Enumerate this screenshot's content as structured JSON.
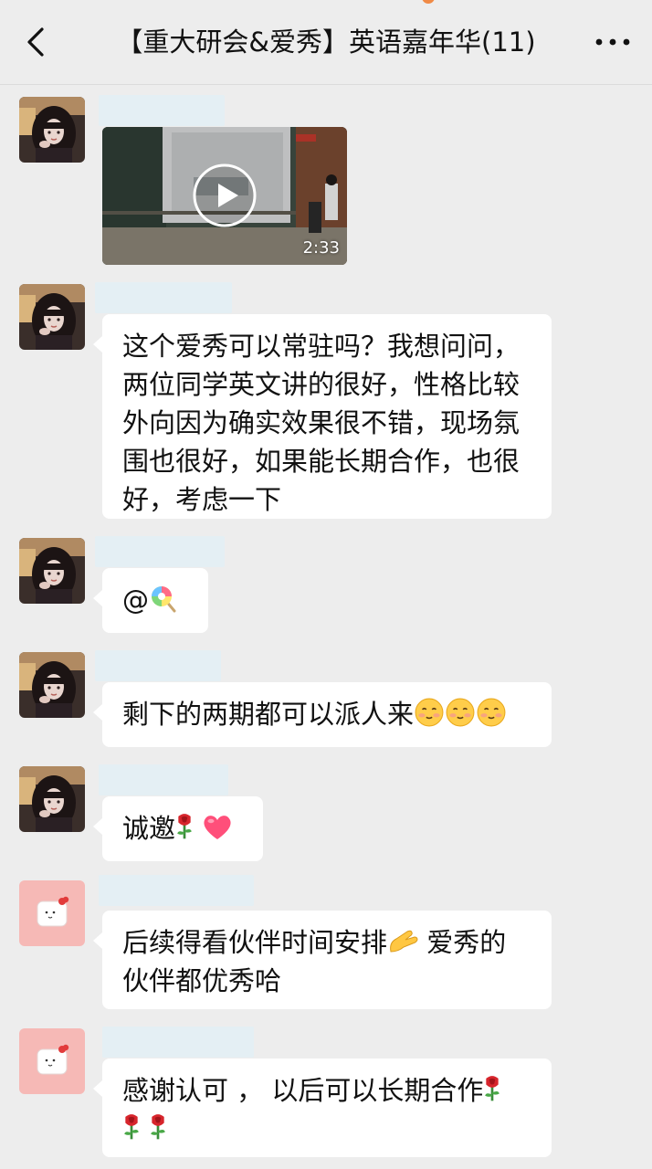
{
  "header": {
    "title": "【重大研会&爱秀】英语嘉年华(11)",
    "back_icon": "chevron-left-icon",
    "more_icon": "more-dots-icon"
  },
  "messages": [
    {
      "type": "video",
      "avatar": "girl-avatar",
      "duration": "2:33"
    },
    {
      "type": "text",
      "avatar": "girl-avatar",
      "lines": [
        "这个爱秀可以常驻吗？我想问问，",
        "两位同学英文讲的很好，性格比较",
        "外向因为确实效果很不错，现场氛",
        "围也很好，如果能长期合作，也很",
        "好，考虑一下"
      ]
    },
    {
      "type": "text",
      "avatar": "girl-avatar",
      "text": "@",
      "emoji": [
        "lollipop"
      ]
    },
    {
      "type": "text",
      "avatar": "girl-avatar",
      "text": "剩下的两期都可以派人来",
      "emoji": [
        "smiling-face",
        "smiling-face",
        "smiling-face"
      ]
    },
    {
      "type": "text",
      "avatar": "girl-avatar",
      "text": "诚邀",
      "emoji": [
        "rose",
        "heart"
      ]
    },
    {
      "type": "text",
      "avatar": "ghost-avatar",
      "line1": "后续得看伙伴时间安排",
      "line1b": " 爱秀的",
      "line2": "伙伴都优秀哈",
      "emoji": [
        "pinching-hand"
      ]
    },
    {
      "type": "text",
      "avatar": "ghost-avatar",
      "line1": "感谢认可 ， 以后可以长期合作",
      "emoji": [
        "rose",
        "rose",
        "rose"
      ]
    }
  ],
  "colors": {
    "background": "#ededed",
    "bubble": "#ffffff",
    "nickname_placeholder": "#e4eff4",
    "ghost_avatar_bg": "#f6b9b6"
  }
}
